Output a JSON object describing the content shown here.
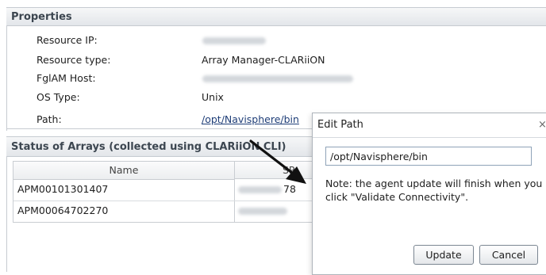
{
  "properties": {
    "header": "Properties",
    "rows": [
      {
        "label": "Resource IP:",
        "value": ""
      },
      {
        "label": "Resource type:",
        "value": "Array Manager-CLARiiON"
      },
      {
        "label": "FglAM Host:",
        "value": ""
      },
      {
        "label": "OS Type:",
        "value": "Unix"
      },
      {
        "label": "Path:",
        "value": "/opt/Navisphere/bin"
      }
    ]
  },
  "status": {
    "header": "Status of Arrays (collected using CLARiiON CLI)",
    "columns": [
      "Name",
      "SP"
    ],
    "rows": [
      {
        "name": "APM00101301407",
        "sp": "78"
      },
      {
        "name": "APM00064702270",
        "sp": ""
      }
    ]
  },
  "dialog": {
    "title": "Edit Path",
    "close_glyph": "×",
    "path_value": "/opt/Navisphere/bin",
    "note": "Note: the agent update will finish when you click \"Validate Connectivity\".",
    "update_label": "Update",
    "cancel_label": "Cancel"
  },
  "colors": {
    "link": "#1f3e78",
    "header_text": "#3c4650",
    "arrow": "#111111"
  }
}
